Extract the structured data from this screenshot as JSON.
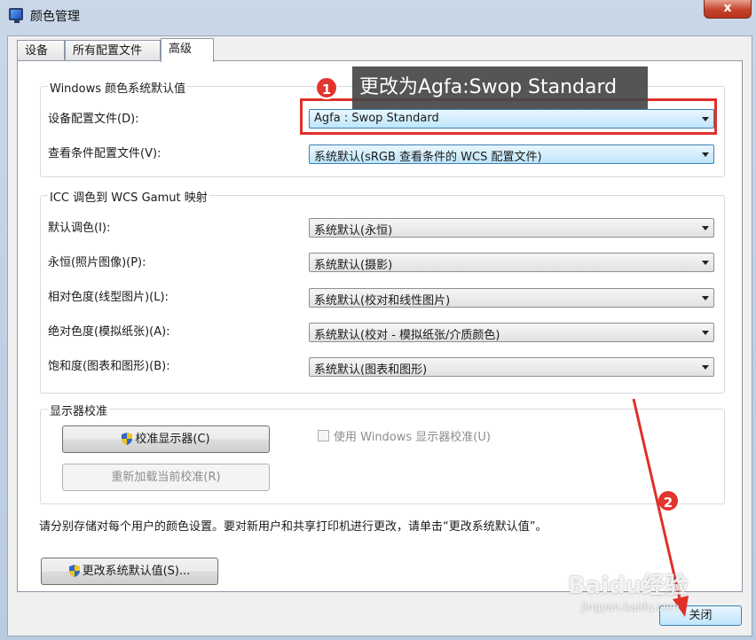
{
  "window": {
    "title": "颜色管理",
    "close_glyph": "x"
  },
  "tabs": [
    {
      "label": "设备",
      "active": false
    },
    {
      "label": "所有配置文件",
      "active": false
    },
    {
      "label": "高级",
      "active": true
    }
  ],
  "defaults_group": {
    "title": "Windows 颜色系统默认值",
    "device_profile_label": "设备配置文件(D):",
    "device_profile_value": "Agfa : Swop Standard",
    "viewing_profile_label": "查看条件配置文件(V):",
    "viewing_profile_value": "系统默认(sRGB 查看条件的 WCS 配置文件)"
  },
  "gamut_group": {
    "title": "ICC 调色到 WCS Gamut 映射",
    "rows": [
      {
        "label": "默认调色(I):",
        "value": "系统默认(永恒)"
      },
      {
        "label": "永恒(照片图像)(P):",
        "value": "系统默认(摄影)"
      },
      {
        "label": "相对色度(线型图片)(L):",
        "value": "系统默认(校对和线性图片)"
      },
      {
        "label": "绝对色度(模拟纸张)(A):",
        "value": "系统默认(校对 - 模拟纸张/介质颜色)"
      },
      {
        "label": "饱和度(图表和图形)(B):",
        "value": "系统默认(图表和图形)"
      }
    ]
  },
  "calibration_group": {
    "title": "显示器校准",
    "calibrate_button": "校准显示器(C)",
    "reload_button": "重新加载当前校准(R)",
    "use_windows_calibration_label": "使用 Windows 显示器校准(U)"
  },
  "footer": {
    "note": "请分别存储对每个用户的颜色设置。要对新用户和共享打印机进行更改，请单击“更改系统默认值”。",
    "change_defaults_button": "更改系统默认值(S)...",
    "close_button": "关闭"
  },
  "annotations": {
    "callout_text": "更改为Agfa:Swop Standard",
    "badge_1": "1",
    "badge_2": "2",
    "watermark": "Baidu经验",
    "watermark_sub": "jingyan.baidu.com",
    "highlight_color": "#e0302a"
  },
  "icons": [
    "monitor-icon",
    "shield-icon",
    "chevron-down-icon"
  ]
}
